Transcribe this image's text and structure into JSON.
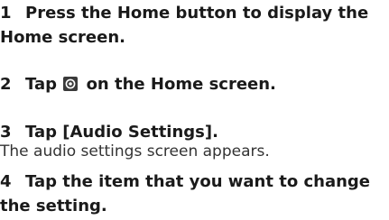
{
  "steps": [
    {
      "number": "1",
      "text_line1": "Press the Home button to display the",
      "text_line2": "Home screen."
    },
    {
      "number": "2",
      "text_before_icon": "Tap",
      "icon": "settings-gear-icon",
      "text_after_icon": "on the Home screen."
    },
    {
      "number": "3",
      "text": "Tap [Audio Settings].",
      "description": "The audio settings screen appears."
    },
    {
      "number": "4",
      "text_line1": "Tap the item that you want to change",
      "text_line2": "the setting."
    }
  ],
  "colors": {
    "text": "#1a1a1a",
    "icon_bg": "#3a3a3a",
    "icon_fg": "#ffffff"
  }
}
